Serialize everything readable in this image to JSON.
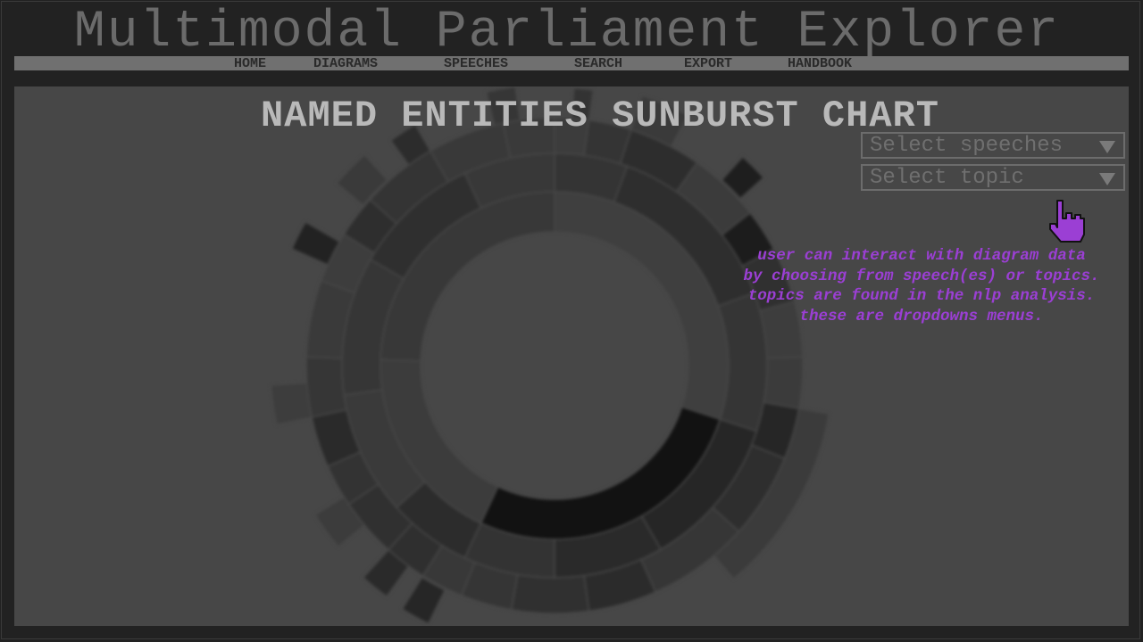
{
  "app": {
    "title": "Multimodal Parliament Explorer"
  },
  "nav": {
    "items": [
      {
        "label": "HOME"
      },
      {
        "label": "DIAGRAMS"
      },
      {
        "label": "SPEECHES"
      },
      {
        "label": "SEARCH"
      },
      {
        "label": "EXPORT"
      },
      {
        "label": "HANDBOOK"
      }
    ]
  },
  "panel": {
    "title": "NAMED ENTITIES SUNBURST CHART",
    "dropdowns": {
      "speeches": {
        "placeholder": "Select speeches",
        "icon": "triangle-down"
      },
      "topic": {
        "placeholder": "Select topic",
        "icon": "triangle-down"
      }
    },
    "cursor_icon": "pointing-hand-cursor",
    "note": {
      "lines": [
        "user can interact with diagram data",
        "by choosing from speech(es) or topics.",
        "topics are found in the nlp analysis.",
        "these are dropdowns menus."
      ]
    }
  },
  "colors": {
    "background": "#222222",
    "panel": "#474747",
    "title": "#6b6b6b",
    "navbar": "#707070",
    "accent_note": "#9b3fd4"
  }
}
